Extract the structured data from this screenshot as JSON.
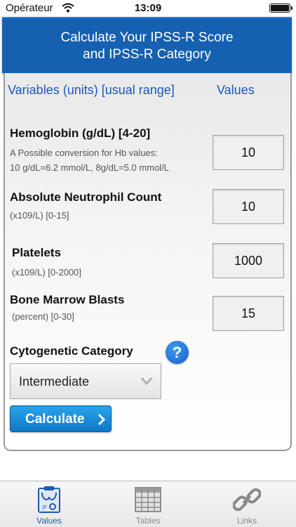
{
  "status_bar": {
    "carrier": "Opérateur",
    "time": "13:09"
  },
  "header": {
    "title": "Calculate Your IPSS-R Score\nand IPSS-R Category"
  },
  "columns": {
    "variables": "Variables (units) [usual range]",
    "values": "Values"
  },
  "variables": [
    {
      "label": "Hemoglobin (g/dL) [4-20]",
      "note": "A Possible conversion for Hb values:\n10 g/dL=6.2 mmol/L, 8g/dL=5.0 mmol/L",
      "value": "10"
    },
    {
      "label": "Absolute Neutrophil Count",
      "note": "(x109/L) [0-15]",
      "value": "10"
    },
    {
      "label": "Platelets",
      "note": "(x109/L) [0-2000]",
      "value": "1000"
    },
    {
      "label": "Bone Marrow Blasts",
      "note": "(percent) [0-30]",
      "value": "15"
    }
  ],
  "cytogenetic": {
    "label": "Cytogenetic Category",
    "help": "?",
    "selected": "Intermediate"
  },
  "calculate_button": "Calculate",
  "tabs": [
    {
      "label": "Values",
      "icon": "values-clipboard-icon",
      "active": true
    },
    {
      "label": "Tables",
      "icon": "table-grid-icon",
      "active": false
    },
    {
      "label": "Links",
      "icon": "chain-link-icon",
      "active": false
    }
  ],
  "colors": {
    "header": "#1560b0",
    "accent_text": "#1e56b7",
    "button": "#0d78c9"
  }
}
